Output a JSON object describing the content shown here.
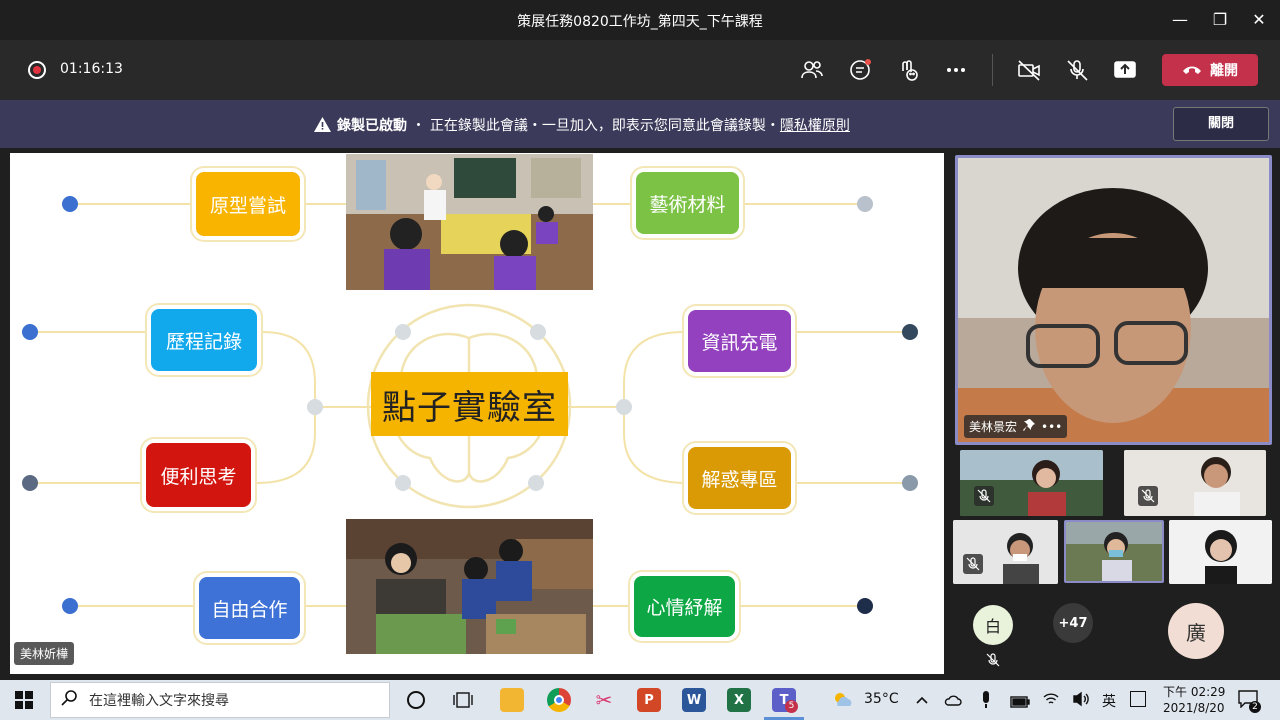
{
  "window": {
    "title": "策展任務0820工作坊_第四天_下午課程",
    "minimize": "—",
    "restore": "❐",
    "close": "✕"
  },
  "toolbar": {
    "timer": "01:16:13",
    "leave_label": "離開"
  },
  "banner": {
    "recording_label": "錄製已啟動",
    "message": "正在錄製此會議・一旦加入，即表示您同意此會議錄製・",
    "privacy_link": "隱私權原則",
    "close_label": "關閉"
  },
  "slide": {
    "center_title": "點子實驗室",
    "boxes": {
      "prototype": {
        "label": "原型嘗試",
        "color": "#f9b400"
      },
      "process_record": {
        "label": "歷程記錄",
        "color": "#12a9ec"
      },
      "convenient_thinking": {
        "label": "便利思考",
        "color": "#d3150f"
      },
      "free_cooperation": {
        "label": "自由合作",
        "color": "#3f72d6"
      },
      "art_material": {
        "label": "藝術材料",
        "color": "#7cc244"
      },
      "info_charge": {
        "label": "資訊充電",
        "color": "#9341be"
      },
      "problem_solving": {
        "label": "解惑專區",
        "color": "#d99a05"
      },
      "mood_relief": {
        "label": "心情紓解",
        "color": "#0da845"
      }
    },
    "speaker_name": "美林妡樺"
  },
  "participants": {
    "main": {
      "name": "美林景宏"
    },
    "more_count": "+47",
    "avatar_white": "白",
    "avatar_guang": "廣"
  },
  "taskbar": {
    "search_placeholder": "在這裡輸入文字來搜尋",
    "teams_badge": "5",
    "weather": "35°C",
    "ime": "英",
    "time": "下午 02:29",
    "date": "2021/8/20",
    "notif_count": "2"
  }
}
